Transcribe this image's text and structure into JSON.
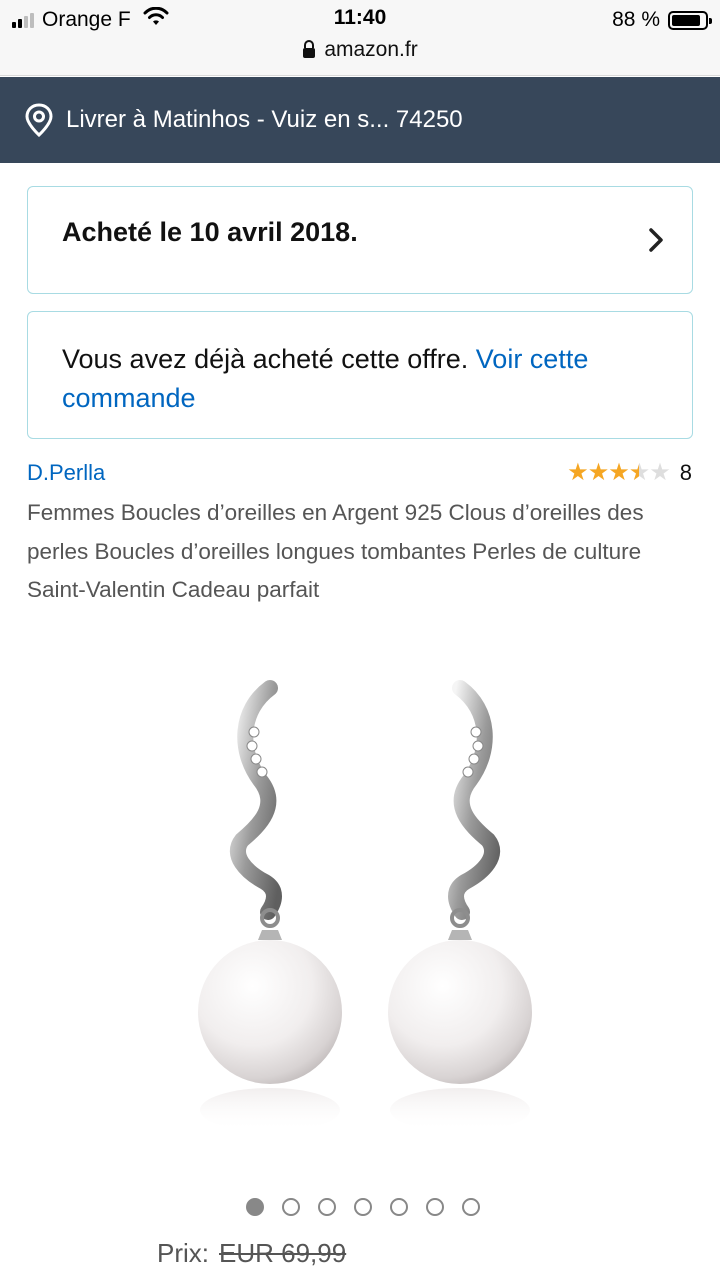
{
  "status_bar": {
    "carrier": "Orange F",
    "time": "11:40",
    "url": "amazon.fr",
    "battery": "88 %"
  },
  "delivery": {
    "text": "Livrer à Matinhos - Vuiz en s... 74250",
    "icon": "location-pin-icon"
  },
  "purchase_card": {
    "text": "Acheté le 10 avril 2018.",
    "icon": "chevron-right-icon"
  },
  "offer_card": {
    "text": "Vous avez déjà acheté cette offre. ",
    "link": "Voir cette commande"
  },
  "product": {
    "brand": "D.Perlla",
    "rating_value": 3.5,
    "rating_count": "8",
    "title": "Femmes Boucles d’oreilles en Argent 925 Clous d’oreilles des perles Boucles d’oreilles longues tombantes Perles de culture Saint-Valentin Cadeau parfait",
    "image_count": 7,
    "active_image": 0
  },
  "price": {
    "label": "Prix:",
    "old_price": "EUR 69,99"
  },
  "colors": {
    "delivery_bar": "#37475a",
    "link": "#0066c0",
    "star": "#f5a623",
    "card_border": "#a8dbe3"
  }
}
